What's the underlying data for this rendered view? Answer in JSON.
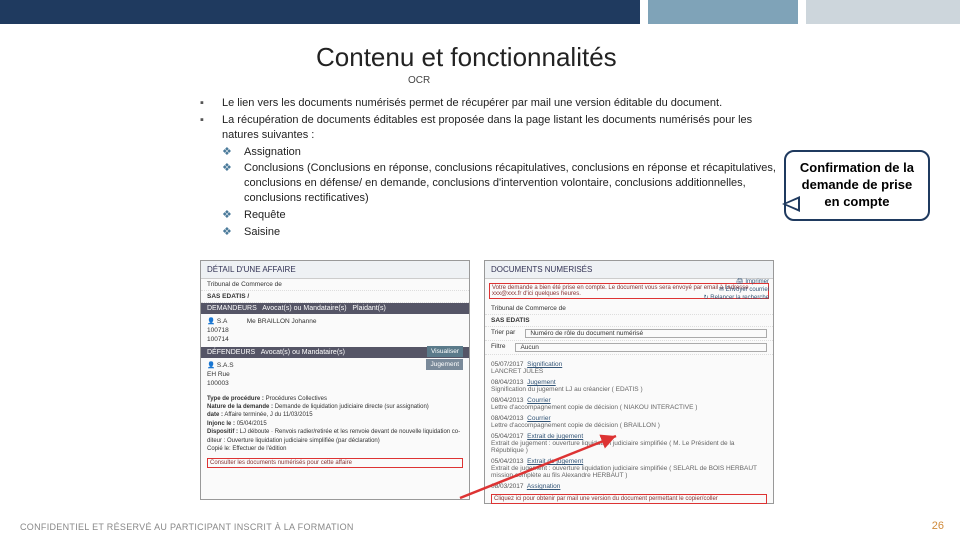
{
  "title": "Contenu et fonctionnalités",
  "subtitle": "OCR",
  "bullets": {
    "b1": "Le lien vers les documents numérisés permet de récupérer par mail une version éditable du document.",
    "b2": "La récupération de documents éditables est proposée dans la page listant les documents numérisés pour les natures suivantes :",
    "d1": "Assignation",
    "d2": "Conclusions (Conclusions en réponse, conclusions récapitulatives, conclusions en réponse et récapitulatives, conclusions en défense/ en demande, conclusions d'intervention volontaire, conclusions additionnelles, conclusions rectificatives)",
    "d3": "Requête",
    "d4": "Saisine"
  },
  "callout": {
    "l1": "Confirmation de la",
    "l2": "demande de prise",
    "l3": "en compte"
  },
  "shotA": {
    "header": "DÉTAIL D'UNE AFFAIRE",
    "tribunal": "Tribunal de Commerce de",
    "party": "SAS EDATIS /",
    "sec1": "DEMANDEURS",
    "col2": "Avocat(s) ou Mandataire(s)",
    "col3": "Plaidant(s)",
    "name1_a": "S.A",
    "name1_b": "100718",
    "name1_c": "100714",
    "avocat1": "Me BRAILLON Johanne",
    "visu": "Visualiser",
    "jug": "Jugement",
    "sec2": "DÉFENDEURS",
    "name2_a": "S.A.S",
    "name2_b": "EH Rue",
    "name2_c": "100003",
    "type_lbl": "Type de procédure :",
    "type_val": "Procédures Collectives",
    "nature_lbl": "Nature de la demande :",
    "nature_val": "Demande de liquidation judiciaire directe (sur assignation)",
    "date_lbl": "date :",
    "date_val": "Affaire terminée, J du 11/03/2015",
    "injonc_lbl": "Injonc le :",
    "injonc_val": "05/04/2015",
    "disp_lbl": "Dispositif :",
    "disp_val": "LJ déboute · Renvois radier/retirée et les renvoie devant de nouvelle liquidation co-diteur : Ouverture liquidation judiciaire simplifiée (par déclaration)",
    "copie": "Copié le: Effectuer de l'édition",
    "link": "Consulter les documents numérisés pour cette affaire"
  },
  "shotB": {
    "header": "DOCUMENTS NUMERISÉS",
    "banner": "Votre demande a bien été prise en compte. Le document vous sera envoyé par email à l'adresse xxx@xxx.fr d'ici quelques heures.",
    "trib": "Tribunal de Commerce de",
    "party": "SAS EDATIS",
    "trier": "Trier par",
    "trierv": "Numéro de rôle du document numérisé",
    "filtre": "Filtre",
    "filtrev": "Aucun",
    "icons": {
      "imp": "Imprimer",
      "env": "Envoyer courriel",
      "rel": "Relancer la recherche"
    },
    "docs": [
      {
        "date": "05/07/2017",
        "type": "Signification",
        "sub": "LANCRET JULES"
      },
      {
        "date": "08/04/2013",
        "type": "Jugement",
        "sub": "Signification du jugement LJ au créancier ( EDATIS )"
      },
      {
        "date": "08/04/2013",
        "type": "Courrier",
        "sub": "Lettre d'accompagnement copie de décision ( NIAKOU INTERACTIVE )"
      },
      {
        "date": "08/04/2013",
        "type": "Courrier",
        "sub": "Lettre d'accompagnement copie de décision ( BRAILLON )"
      },
      {
        "date": "05/04/2017",
        "type": "Extrait de jugement",
        "sub": "Extrait de jugement : ouverture liquidation judiciaire simplifiée ( M. Le Président de la République )"
      },
      {
        "date": "05/04/2013",
        "type": "Extrait de jugement",
        "sub": "Extrait de jugement : ouverture liquidation judiciaire simplifiée ( SELARL de BOIS HERBAUT mission complète au fils Alexandre HERBAUT )"
      },
      {
        "date": "08/03/2017",
        "type": "Assignation",
        "sub": ""
      }
    ],
    "bottom_link": "Cliquez ici pour obtenir par mail une version du document permettant le copier/coller"
  },
  "footer": "CONFIDENTIEL ET RÉSERVÉ AU PARTICIPANT INSCRIT À LA FORMATION",
  "page": "26"
}
